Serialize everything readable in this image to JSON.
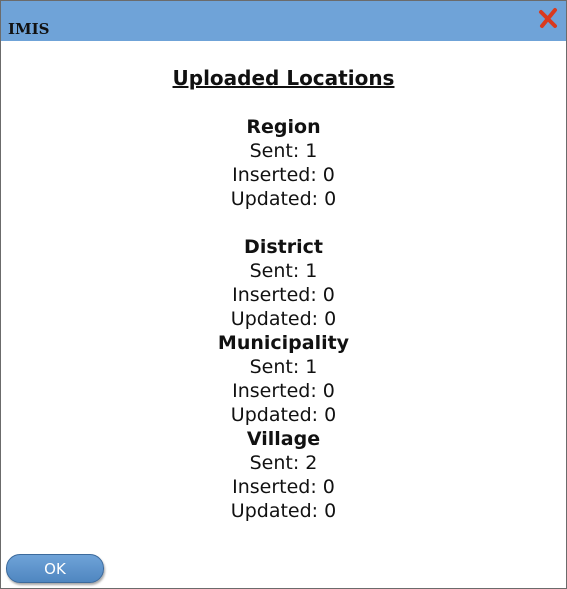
{
  "window": {
    "title": "IMIS"
  },
  "heading": "Uploaded Locations",
  "sections": [
    {
      "title": "Region",
      "sent": "Sent: 1",
      "inserted": "Inserted: 0",
      "updated": "Updated: 0"
    },
    {
      "title": "District",
      "sent": "Sent: 1",
      "inserted": "Inserted: 0",
      "updated": "Updated: 0"
    },
    {
      "title": "Municipality",
      "sent": "Sent: 1",
      "inserted": "Inserted: 0",
      "updated": "Updated: 0"
    },
    {
      "title": "Village",
      "sent": "Sent: 2",
      "inserted": "Inserted: 0",
      "updated": "Updated: 0"
    }
  ],
  "buttons": {
    "ok": "OK"
  },
  "icons": {
    "close": "close-icon"
  },
  "colors": {
    "titlebar": "#6fa3d8",
    "close": "#d93a1e",
    "button": "#5b91c9"
  }
}
